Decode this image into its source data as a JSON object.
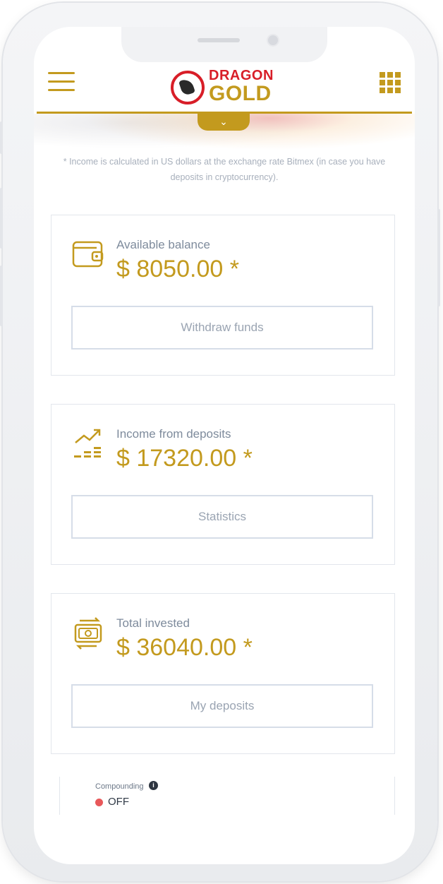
{
  "header": {
    "brand_top": "DRAGON",
    "brand_bottom": "GOLD",
    "menu_icon": "hamburger-menu-icon",
    "apps_icon": "grid-icon",
    "toggle_icon": "chevron-down-icon"
  },
  "note": "* Income is calculated in US dollars at the exchange rate Bitmex (in case you have deposits in cryptocurrency).",
  "cards": [
    {
      "icon": "wallet-icon",
      "label": "Available balance",
      "amount": "$ 8050.00 *",
      "button": "Withdraw funds"
    },
    {
      "icon": "growth-chart-icon",
      "label": "Income from deposits",
      "amount": "$ 17320.00 *",
      "button": "Statistics"
    },
    {
      "icon": "money-exchange-icon",
      "label": "Total invested",
      "amount": "$ 36040.00 *",
      "button": "My deposits"
    }
  ],
  "compounding": {
    "label": "Compounding",
    "state": "OFF",
    "status_color": "#e8585a"
  },
  "colors": {
    "accent_gold": "#c39a1e",
    "brand_red": "#d81e28",
    "muted_text": "#7e8b9c"
  }
}
